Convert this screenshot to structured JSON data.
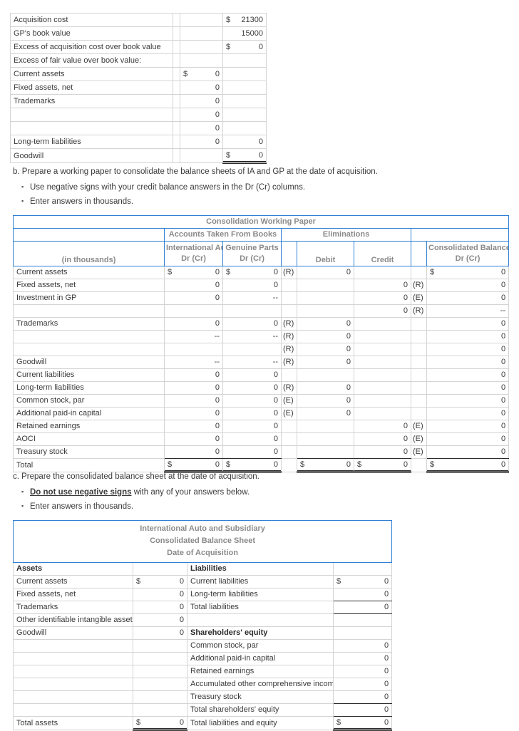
{
  "acquisition_schedule": {
    "name": "acquisition-cost-schedule",
    "rows": [
      {
        "label": "Acquisition cost",
        "c2": "",
        "c3_cur": "$",
        "c3": "21300",
        "c4_cur": "",
        "c4": ""
      },
      {
        "label": "GP's book value",
        "c2": "",
        "c3_cur": "",
        "c3": "15000",
        "c4_cur": "",
        "c4": ""
      },
      {
        "label": "Excess of acquisition cost over book value",
        "c2": "",
        "c3_cur": "$",
        "c3": "0",
        "c4_cur": "",
        "c4": ""
      },
      {
        "label": "Excess of fair value over book value:",
        "c2": "",
        "c3_cur": "",
        "c3": "",
        "c4_cur": "",
        "c4": ""
      },
      {
        "label": "Current assets",
        "c2": "",
        "c3_cur": "",
        "c3": "",
        "c4_cur": "$",
        "c4": "0"
      },
      {
        "label": "Fixed assets, net",
        "c2": "",
        "c3_cur": "",
        "c3": "",
        "c4_cur": "",
        "c4": "0"
      },
      {
        "label": "Trademarks",
        "c2": "",
        "c3_cur": "",
        "c3": "",
        "c4_cur": "",
        "c4": "0"
      },
      {
        "label": "",
        "c2": "",
        "c3_cur": "",
        "c3": "",
        "c4_cur": "",
        "c4": "0"
      },
      {
        "label": "",
        "c2": "",
        "c3_cur": "",
        "c3": "",
        "c4_cur": "",
        "c4": "0"
      },
      {
        "label": "Long-term liabilities",
        "c2": "",
        "c3_cur": "",
        "c3": "0",
        "c4_cur": "",
        "c4": "0"
      },
      {
        "label": "Goodwill",
        "c2": "",
        "c3_cur": "$",
        "c3": "0",
        "c4_cur": "",
        "c4": ""
      }
    ]
  },
  "part_b": {
    "lead": "b. Prepare a working paper to consolidate the balance sheets of IA and GP at the date of acquisition.",
    "bullets": [
      "Use negative signs with your credit balance answers in the Dr (Cr) columns.",
      "Enter answers in thousands."
    ]
  },
  "working_paper": {
    "title": "Consolidation Working Paper",
    "group_books": "Accounts Taken From Books",
    "group_eliminations": "Eliminations",
    "col_units": "(in thousands)",
    "col_ia_l1": "International Auto",
    "col_ia_l2": "Dr (Cr)",
    "col_gp_l1": "Genuine Parts",
    "col_gp_l2": "Dr (Cr)",
    "col_debit": "Debit",
    "col_credit": "Credit",
    "col_cons_l1": "Consolidated Balances",
    "col_cons_l2": "Dr (Cr)",
    "rows": [
      {
        "label": "Current assets",
        "ia_cur": "$",
        "ia": "0",
        "gp_cur": "$",
        "gp": "0",
        "dkey": "(R)",
        "debit": "0",
        "credit": "",
        "ckey": "",
        "cons_cur": "$",
        "cons": "0"
      },
      {
        "label": "Fixed assets, net",
        "ia_cur": "",
        "ia": "0",
        "gp_cur": "",
        "gp": "0",
        "dkey": "",
        "debit": "",
        "credit": "0",
        "ckey": "(R)",
        "cons_cur": "",
        "cons": "0"
      },
      {
        "label": "Investment in GP",
        "ia_cur": "",
        "ia": "0",
        "gp_cur": "",
        "gp": "--",
        "dkey": "",
        "debit": "",
        "credit": "0",
        "ckey": "(E)",
        "cons_cur": "",
        "cons": "0"
      },
      {
        "label": "",
        "ia_cur": "",
        "ia": "",
        "gp_cur": "",
        "gp": "",
        "dkey": "",
        "debit": "",
        "credit": "0",
        "ckey": "(R)",
        "cons_cur": "",
        "cons": "--"
      },
      {
        "label": "Trademarks",
        "ia_cur": "",
        "ia": "0",
        "gp_cur": "",
        "gp": "0",
        "dkey": "(R)",
        "debit": "0",
        "credit": "",
        "ckey": "",
        "cons_cur": "",
        "cons": "0"
      },
      {
        "label": "",
        "ia_cur": "",
        "ia": "--",
        "gp_cur": "",
        "gp": "--",
        "dkey": "(R)",
        "debit": "0",
        "credit": "",
        "ckey": "",
        "cons_cur": "",
        "cons": "0"
      },
      {
        "label": "",
        "ia_cur": "",
        "ia": "",
        "gp_cur": "",
        "gp": "",
        "dkey": "(R)",
        "debit": "0",
        "credit": "",
        "ckey": "",
        "cons_cur": "",
        "cons": "0"
      },
      {
        "label": "Goodwill",
        "ia_cur": "",
        "ia": "--",
        "gp_cur": "",
        "gp": "--",
        "dkey": "(R)",
        "debit": "0",
        "credit": "",
        "ckey": "",
        "cons_cur": "",
        "cons": "0"
      },
      {
        "label": "Current liabilities",
        "ia_cur": "",
        "ia": "0",
        "gp_cur": "",
        "gp": "0",
        "dkey": "",
        "debit": "",
        "credit": "",
        "ckey": "",
        "cons_cur": "",
        "cons": "0"
      },
      {
        "label": "Long-term liabilities",
        "ia_cur": "",
        "ia": "0",
        "gp_cur": "",
        "gp": "0",
        "dkey": "(R)",
        "debit": "0",
        "credit": "",
        "ckey": "",
        "cons_cur": "",
        "cons": "0"
      },
      {
        "label": "Common stock, par",
        "ia_cur": "",
        "ia": "0",
        "gp_cur": "",
        "gp": "0",
        "dkey": "(E)",
        "debit": "0",
        "credit": "",
        "ckey": "",
        "cons_cur": "",
        "cons": "0"
      },
      {
        "label": "Additional paid-in capital",
        "ia_cur": "",
        "ia": "0",
        "gp_cur": "",
        "gp": "0",
        "dkey": "(E)",
        "debit": "0",
        "credit": "",
        "ckey": "",
        "cons_cur": "",
        "cons": "0"
      },
      {
        "label": "Retained earnings",
        "ia_cur": "",
        "ia": "0",
        "gp_cur": "",
        "gp": "0",
        "dkey": "",
        "debit": "",
        "credit": "0",
        "ckey": "(E)",
        "cons_cur": "",
        "cons": "0"
      },
      {
        "label": "AOCI",
        "ia_cur": "",
        "ia": "0",
        "gp_cur": "",
        "gp": "0",
        "dkey": "",
        "debit": "",
        "credit": "0",
        "ckey": "(E)",
        "cons_cur": "",
        "cons": "0"
      },
      {
        "label": "Treasury stock",
        "ia_cur": "",
        "ia": "0",
        "gp_cur": "",
        "gp": "0",
        "dkey": "",
        "debit": "",
        "credit": "0",
        "ckey": "(E)",
        "cons_cur": "",
        "cons": "0"
      }
    ],
    "total_row": {
      "label": "Total",
      "ia_cur": "$",
      "ia": "0",
      "gp_cur": "$",
      "gp": "0",
      "dkey": "",
      "debit_cur": "$",
      "debit": "0",
      "credit_cur": "$",
      "credit": "0",
      "ckey": "",
      "cons_cur": "$",
      "cons": "0"
    }
  },
  "part_c": {
    "lead": "c. Prepare the consolidated balance sheet at the date of acquisition.",
    "bullet1_emph": "Do not use negative signs",
    "bullet1_rest": " with any of your answers below.",
    "bullet2": "Enter answers in thousands."
  },
  "balance_sheet": {
    "title_l1": "International Auto and Subsidiary",
    "title_l2": "Consolidated Balance Sheet",
    "title_l3": "Date of Acquisition",
    "head_assets": "Assets",
    "head_liabilities": "Liabilities",
    "rows": [
      {
        "a_label": "Current assets",
        "a_cur": "$",
        "a_val": "0",
        "l_label": "Current liabilities",
        "l_bold": false,
        "l_cur": "$",
        "l_val": "0"
      },
      {
        "a_label": "Fixed assets, net",
        "a_cur": "",
        "a_val": "0",
        "l_label": "Long-term liabilities",
        "l_bold": false,
        "l_cur": "",
        "l_val": "0"
      },
      {
        "a_label": "Trademarks",
        "a_cur": "",
        "a_val": "0",
        "l_label": "Total liabilities",
        "l_bold": false,
        "l_cur": "",
        "l_val": "0"
      },
      {
        "a_label": "Other identifiable intangible assets",
        "a_cur": "",
        "a_val": "0",
        "l_label": "",
        "l_bold": false,
        "l_cur": "",
        "l_val": ""
      },
      {
        "a_label": "Goodwill",
        "a_cur": "",
        "a_val": "0",
        "l_label": "Shareholders' equity",
        "l_bold": true,
        "l_cur": "",
        "l_val": ""
      },
      {
        "a_label": "",
        "a_cur": "",
        "a_val": "",
        "l_label": "Common stock, par",
        "l_bold": false,
        "l_cur": "",
        "l_val": "0"
      },
      {
        "a_label": "",
        "a_cur": "",
        "a_val": "",
        "l_label": "Additional paid-in capital",
        "l_bold": false,
        "l_cur": "",
        "l_val": "0"
      },
      {
        "a_label": "",
        "a_cur": "",
        "a_val": "",
        "l_label": "Retained earnings",
        "l_bold": false,
        "l_cur": "",
        "l_val": "0"
      },
      {
        "a_label": "",
        "a_cur": "",
        "a_val": "",
        "l_label": "Accumulated other comprehensive income",
        "l_bold": false,
        "l_cur": "",
        "l_val": "0"
      },
      {
        "a_label": "",
        "a_cur": "",
        "a_val": "",
        "l_label": "Treasury stock",
        "l_bold": false,
        "l_cur": "",
        "l_val": "0"
      },
      {
        "a_label": "",
        "a_cur": "",
        "a_val": "",
        "l_label": "Total shareholders' equity",
        "l_bold": false,
        "l_cur": "",
        "l_val": "0"
      }
    ],
    "total_row": {
      "a_label": "Total assets",
      "a_cur": "$",
      "a_val": "0",
      "l_label": "Total liabilities and equity",
      "l_cur": "$",
      "l_val": "0"
    }
  }
}
